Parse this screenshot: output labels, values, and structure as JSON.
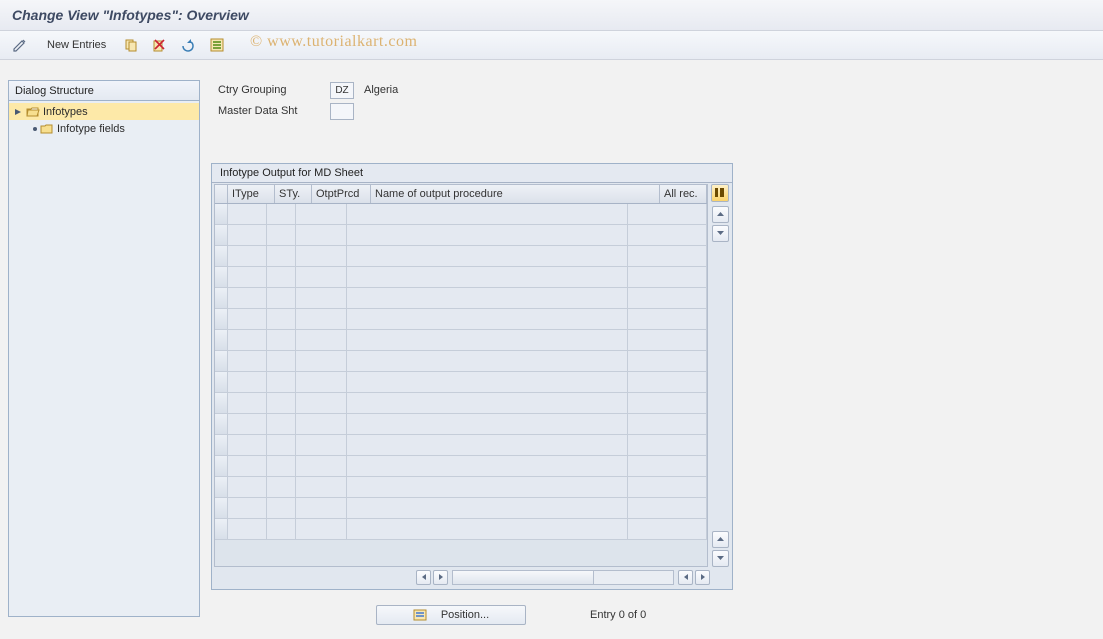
{
  "title": "Change View \"Infotypes\": Overview",
  "watermark": "©  www.tutorialkart.com",
  "toolbar": {
    "new_entries": "New Entries"
  },
  "tree": {
    "header": "Dialog Structure",
    "root": "Infotypes",
    "child": "Infotype fields"
  },
  "form": {
    "ctry_grouping_label": "Ctry Grouping",
    "ctry_grouping_value": "DZ",
    "ctry_grouping_desc": "Algeria",
    "master_data_label": "Master Data Sht",
    "master_data_value": ""
  },
  "grid": {
    "title": "Infotype Output for MD Sheet",
    "columns": {
      "itype": "IType",
      "sty": "STy.",
      "otptprcd": "OtptPrcd",
      "name_output_proc": "Name of output procedure",
      "all_rec": "All rec."
    },
    "col_widths": {
      "itype": 38,
      "sty": 28,
      "otptprcd": 50,
      "name_output_proc": 280,
      "all_rec": 60
    },
    "row_count": 16
  },
  "footer": {
    "position_btn": "Position...",
    "entry_text": "Entry 0 of 0"
  }
}
